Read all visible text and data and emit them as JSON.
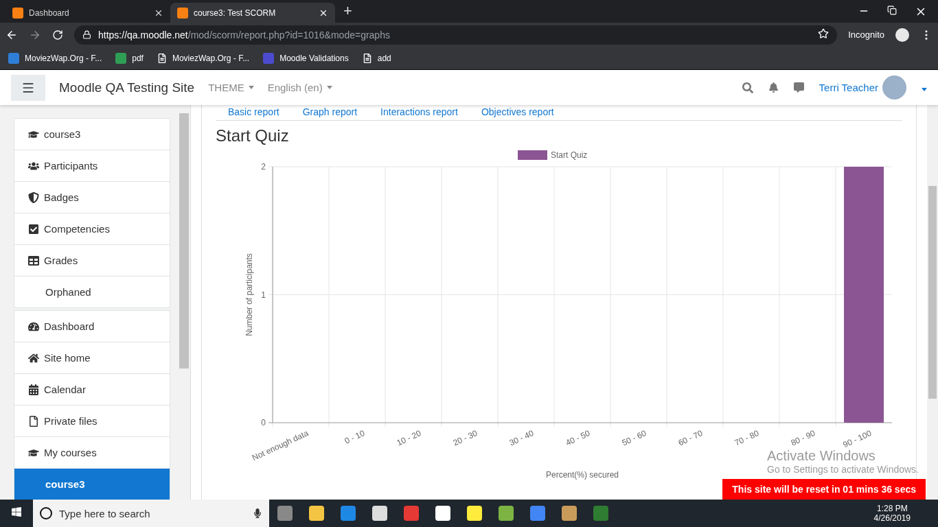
{
  "browser": {
    "tabs": [
      {
        "title": "Dashboard",
        "selected": false
      },
      {
        "title": "course3: Test SCORM",
        "selected": true
      }
    ],
    "new_tab": "+",
    "url": {
      "host": "https://qa.moodle.net",
      "path": "/mod/scorm/report.php?id=1016&mode=graphs"
    },
    "profile": "Incognito",
    "bookmarks": [
      "MoviezWap.Org - F...",
      "pdf",
      "MoviezWap.Org - F...",
      "Moodle Validations",
      "add"
    ]
  },
  "navbar": {
    "site_name": "Moodle QA Testing Site",
    "menus": [
      "THEME",
      "English (en)"
    ],
    "user": "Terri Teacher"
  },
  "sidebar": {
    "groups": [
      [
        {
          "label": "course3",
          "selected": false
        },
        {
          "label": "Participants",
          "selected": false
        },
        {
          "label": "Badges",
          "selected": false
        },
        {
          "label": "Competencies",
          "selected": false
        },
        {
          "label": "Grades",
          "selected": false
        },
        {
          "label": "Orphaned",
          "selected": false
        }
      ],
      [
        {
          "label": "Dashboard",
          "selected": false
        },
        {
          "label": "Site home",
          "selected": false
        },
        {
          "label": "Calendar",
          "selected": false
        },
        {
          "label": "Private files",
          "selected": false
        },
        {
          "label": "My courses",
          "selected": false
        },
        {
          "label": "course3",
          "selected": true
        }
      ]
    ]
  },
  "report_tabs": [
    "Basic report",
    "Graph report",
    "Interactions report",
    "Objectives report"
  ],
  "heading": "Start Quiz",
  "chart_data": {
    "type": "bar",
    "xlabel": "Percent(%) secured",
    "ylabel": "Number of participants",
    "categories": [
      "Not enough data",
      "0 - 10",
      "10 - 20",
      "20 - 30",
      "30 - 40",
      "40 - 50",
      "50 - 60",
      "60 - 70",
      "70 - 80",
      "80 - 90",
      "90 - 100"
    ],
    "series": [
      {
        "name": "Start Quiz",
        "color": "#8b5593",
        "values": [
          0,
          0,
          0,
          0,
          0,
          0,
          0,
          0,
          0,
          0,
          2
        ]
      }
    ],
    "ylim": [
      0,
      2
    ],
    "yticks": [
      0,
      1,
      2
    ]
  },
  "windows_notice": {
    "title": "Activate Windows",
    "text": "Go to Settings to activate Windows."
  },
  "reset_banner": "This site will be reset in 01 mins 36 secs",
  "taskbar": {
    "search_placeholder": "Type here to search",
    "time": "1:28 PM",
    "date": "4/26/2019"
  }
}
